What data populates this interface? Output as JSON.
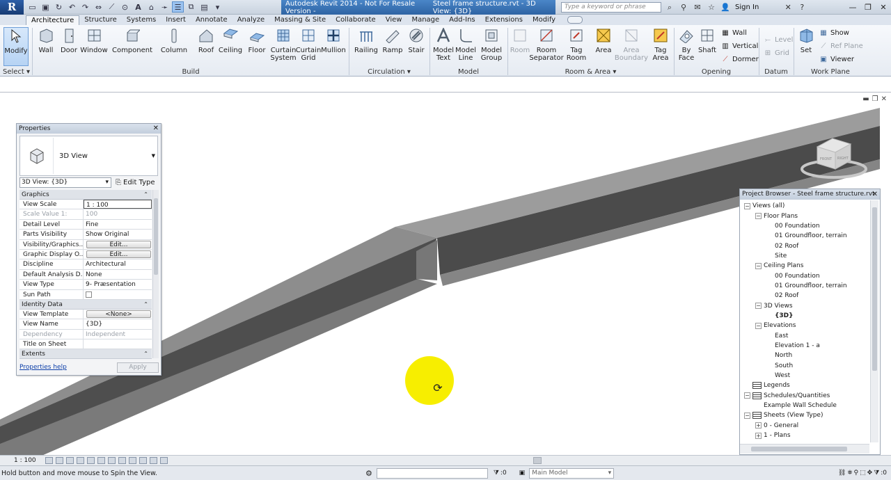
{
  "window": {
    "app_title": "Autodesk Revit 2014 - Not For Resale Version -",
    "doc_title": "Steel frame structure.rvt - 3D View: {3D}",
    "search_placeholder": "Type a keyword or phrase",
    "sign_in": "Sign In",
    "logo_letter": "R"
  },
  "tabs": [
    "Architecture",
    "Structure",
    "Systems",
    "Insert",
    "Annotate",
    "Analyze",
    "Massing & Site",
    "Collaborate",
    "View",
    "Manage",
    "Add-Ins",
    "Extensions",
    "Modify"
  ],
  "ribbon": {
    "modify": "Modify",
    "select": "Select",
    "build": [
      "Wall",
      "Door",
      "Window",
      "Component",
      "Column",
      "Roof",
      "Ceiling",
      "Floor",
      "Curtain System",
      "Curtain Grid",
      "Mullion"
    ],
    "circulation": [
      "Railing",
      "Ramp",
      "Stair"
    ],
    "model": [
      "Model Text",
      "Model Line",
      "Model Group"
    ],
    "room_area": [
      "Room",
      "Room Separator",
      "Tag Room",
      "Area",
      "Area Boundary",
      "Tag Area"
    ],
    "opening_large": [
      "By Face",
      "Shaft"
    ],
    "opening_small": [
      "Wall",
      "Vertical",
      "Dormer"
    ],
    "datum": [
      "Level",
      "Grid"
    ],
    "work_plane_large": "Set",
    "work_plane_small": [
      "Show",
      "Ref Plane",
      "Viewer"
    ],
    "panels": {
      "select": "Select",
      "build": "Build",
      "circulation": "Circulation",
      "model": "Model",
      "room_area": "Room & Area",
      "opening": "Opening",
      "datum": "Datum",
      "work_plane": "Work Plane"
    }
  },
  "properties": {
    "title": "Properties",
    "type_name": "3D View",
    "view_selector": "3D View: {3D}",
    "edit_type": "Edit Type",
    "groups": {
      "graphics": "Graphics",
      "identity": "Identity Data",
      "extents": "Extents"
    },
    "graphics_rows": [
      {
        "key": "View Scale",
        "value": "1 : 100"
      },
      {
        "key": "Scale Value    1:",
        "value": "100"
      },
      {
        "key": "Detail Level",
        "value": "Fine"
      },
      {
        "key": "Parts Visibility",
        "value": "Show Original"
      },
      {
        "key": "Visibility/Graphics...",
        "value": "Edit..."
      },
      {
        "key": "Graphic Display O...",
        "value": "Edit..."
      },
      {
        "key": "Discipline",
        "value": "Architectural"
      },
      {
        "key": "Default Analysis D...",
        "value": "None"
      },
      {
        "key": "View Type",
        "value": "9- Præsentation"
      },
      {
        "key": "Sun Path",
        "value": ""
      }
    ],
    "identity_rows": [
      {
        "key": "View Template",
        "value": "<None>"
      },
      {
        "key": "View Name",
        "value": "{3D}"
      },
      {
        "key": "Dependency",
        "value": "Independent"
      },
      {
        "key": "Title on Sheet",
        "value": ""
      }
    ],
    "help": "Properties help",
    "apply": "Apply"
  },
  "browser": {
    "title": "Project Browser - Steel frame structure.rvt",
    "nodes": [
      {
        "label": "Views (all)",
        "level": 0,
        "expander": "-"
      },
      {
        "label": "Floor Plans",
        "level": 1,
        "expander": "-"
      },
      {
        "label": "00 Foundation",
        "level": 2
      },
      {
        "label": "01 Groundfloor, terrain",
        "level": 2
      },
      {
        "label": "02 Roof",
        "level": 2
      },
      {
        "label": "Site",
        "level": 2
      },
      {
        "label": "Ceiling Plans",
        "level": 1,
        "expander": "-"
      },
      {
        "label": "00 Foundation",
        "level": 2
      },
      {
        "label": "01 Groundfloor, terrain",
        "level": 2
      },
      {
        "label": "02 Roof",
        "level": 2
      },
      {
        "label": "3D Views",
        "level": 1,
        "expander": "-"
      },
      {
        "label": "{3D}",
        "level": 2,
        "bold": true
      },
      {
        "label": "Elevations",
        "level": 1,
        "expander": "-"
      },
      {
        "label": "East",
        "level": 2
      },
      {
        "label": "Elevation 1 - a",
        "level": 2
      },
      {
        "label": "North",
        "level": 2
      },
      {
        "label": "South",
        "level": 2
      },
      {
        "label": "West",
        "level": 2
      },
      {
        "label": "Legends",
        "level": 0,
        "icon": true
      },
      {
        "label": "Schedules/Quantities",
        "level": 0,
        "expander": "-",
        "icon": true
      },
      {
        "label": "Example Wall Schedule",
        "level": 1
      },
      {
        "label": "Sheets (View Type)",
        "level": 0,
        "expander": "-",
        "icon": true
      },
      {
        "label": "0 - General",
        "level": 1,
        "expander": "+"
      },
      {
        "label": "1 - Plans",
        "level": 1,
        "expander": "+"
      }
    ]
  },
  "viewbar": {
    "scale": "1 : 100"
  },
  "status": {
    "message": "Hold button and move mouse to Spin the View.",
    "sel_count": ":0",
    "main_model": "Main Model",
    "filter_count": ":0"
  },
  "viewcube": {
    "front": "FRONT",
    "right": "RIGHT"
  },
  "colors": {
    "accent": "#2e63a3",
    "highlight": "#f7ee00"
  }
}
